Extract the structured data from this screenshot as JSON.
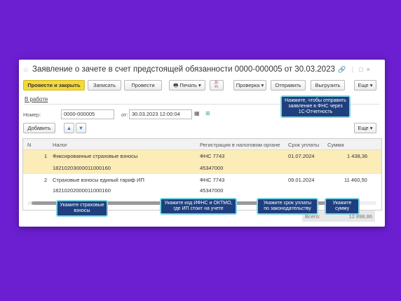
{
  "window": {
    "title": "Заявление о зачете в счет предстоящей обязанности 0000-000005 от 30.03.2023 12:00...",
    "star": "☆"
  },
  "toolbar": {
    "post_close": "Провести и закрыть",
    "save": "Записать",
    "post": "Провести",
    "print": "Печать",
    "check": "Проверка",
    "send": "Отправить",
    "export": "Выгрузить",
    "more": "Еще"
  },
  "status_link": "В работе",
  "form": {
    "number_label": "Номер:",
    "number_value": "0000-000005",
    "from_label": "от:",
    "date_value": "30.03.2023 12:00:04"
  },
  "table_toolbar": {
    "add": "Добавить",
    "more": "Еще"
  },
  "table": {
    "headers": [
      "N",
      "Налог",
      "Регистрация в налоговом органе",
      "Срок уплаты",
      "Сумма"
    ],
    "rows": [
      {
        "n": "1",
        "tax": "Фиксированные страховые взносы",
        "kbk": "18210203000011000160",
        "reg": "ФНС 7743",
        "oktmo": "45347000",
        "due": "01.07.2024",
        "sum": "1 438,36"
      },
      {
        "n": "2",
        "tax": "Страховые взносы единый тариф ИП",
        "kbk": "18210202000011000160",
        "reg": "ФНС 7743",
        "oktmo": "45347000",
        "due": "09.01.2024",
        "sum": "11 460,50"
      }
    ]
  },
  "total": {
    "label": "Всего:",
    "value": "12 898,86"
  },
  "tips": {
    "send": "Нажмите, чтобы отправить заявление в ФНС через 1С-Отчетность",
    "insurance": "Укажите страховые взносы",
    "ifns": "Укажите код ИФНС и ОКТМО, где ИП стоит на учете",
    "due": "Укажите срок уплаты по законодательству",
    "sum": "Укажите сумму"
  },
  "colors": {
    "background": "#6b1fd0",
    "tooltip": "#1f3f7e",
    "accent": "#f5d93a",
    "selected_row": "#fbecb8"
  }
}
